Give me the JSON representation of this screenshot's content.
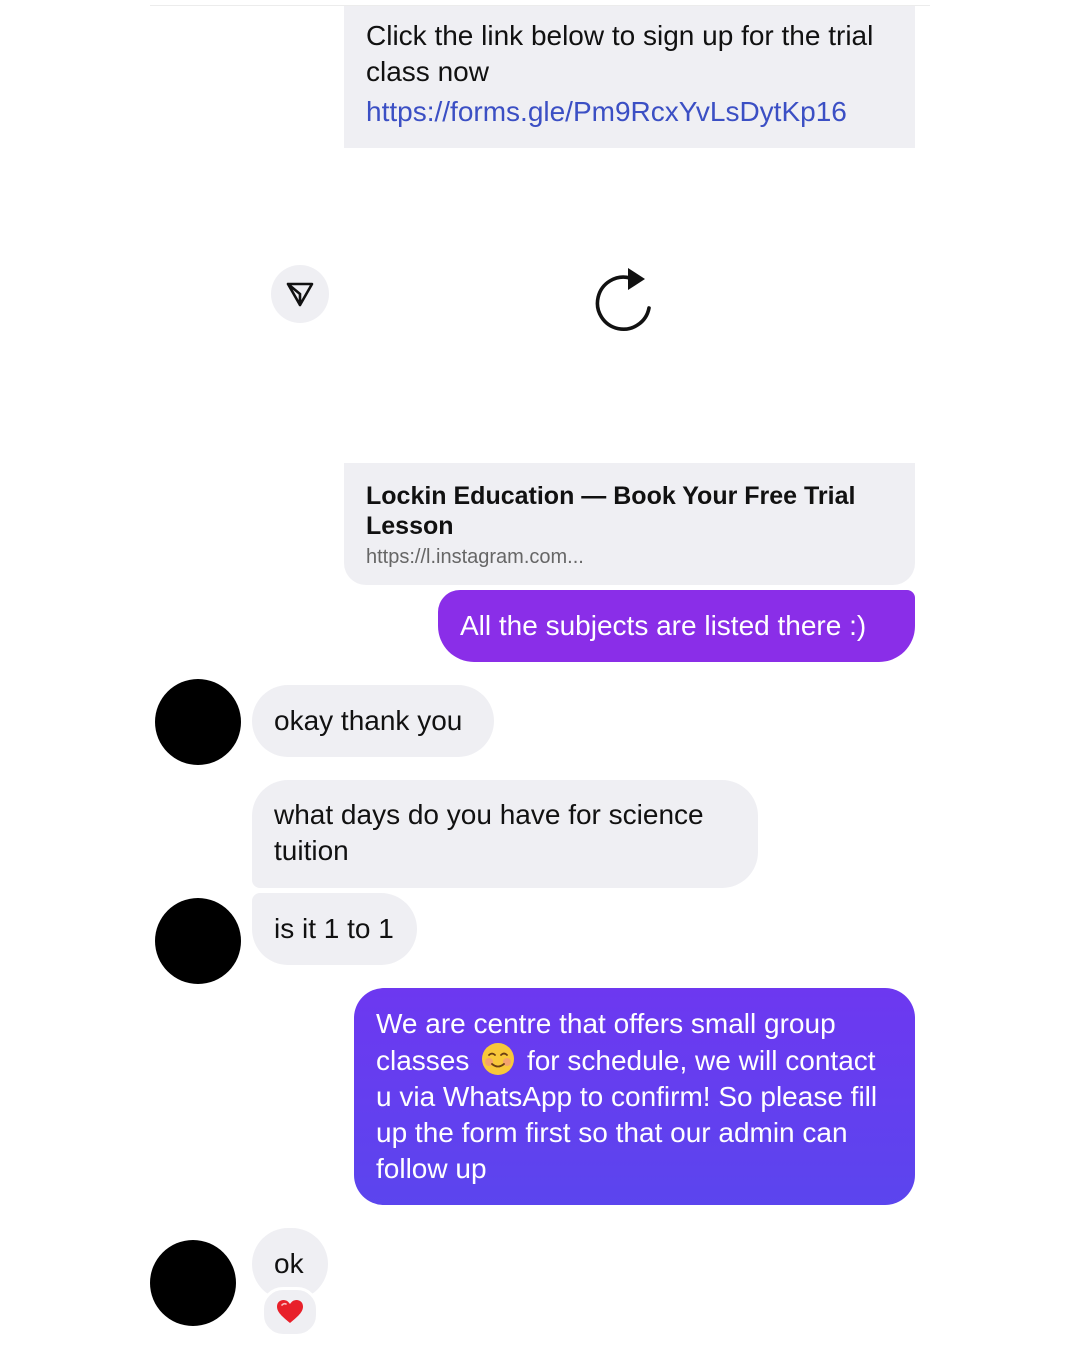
{
  "thread": {
    "link_message": {
      "text": "Click the link below to sign up for the trial class now",
      "url": "https://forms.gle/Pm9RcxYvLsDytKp16"
    },
    "preview": {
      "title": "Lockin Education — Book Your Free Trial Lesson",
      "url": "https://l.instagram.com..."
    },
    "messages": [
      {
        "from": "me",
        "text": "All the subjects are listed there :)"
      },
      {
        "from": "them",
        "text": "okay thank you"
      },
      {
        "from": "them",
        "text": "what days do you have for science tuition"
      },
      {
        "from": "them",
        "text": "is it 1 to 1"
      },
      {
        "from": "me",
        "text_before_emoji": "We are centre that offers small group classes",
        "emoji": "smiling-face-emoji",
        "text_after_emoji": "for schedule, we will contact u via WhatsApp to confirm! So please fill up the form first so that our admin can follow up"
      },
      {
        "from": "them",
        "text": "ok",
        "reaction": "heart-emoji"
      }
    ]
  },
  "icons": {
    "share": "share-icon",
    "reload": "reload-icon",
    "reaction": "heart-emoji"
  },
  "colors": {
    "outgoing_purple": "#8a2ee8",
    "outgoing_violet": "#5b45ee",
    "incoming_gray": "#efeff3",
    "link_blue": "#3b4fc4"
  }
}
